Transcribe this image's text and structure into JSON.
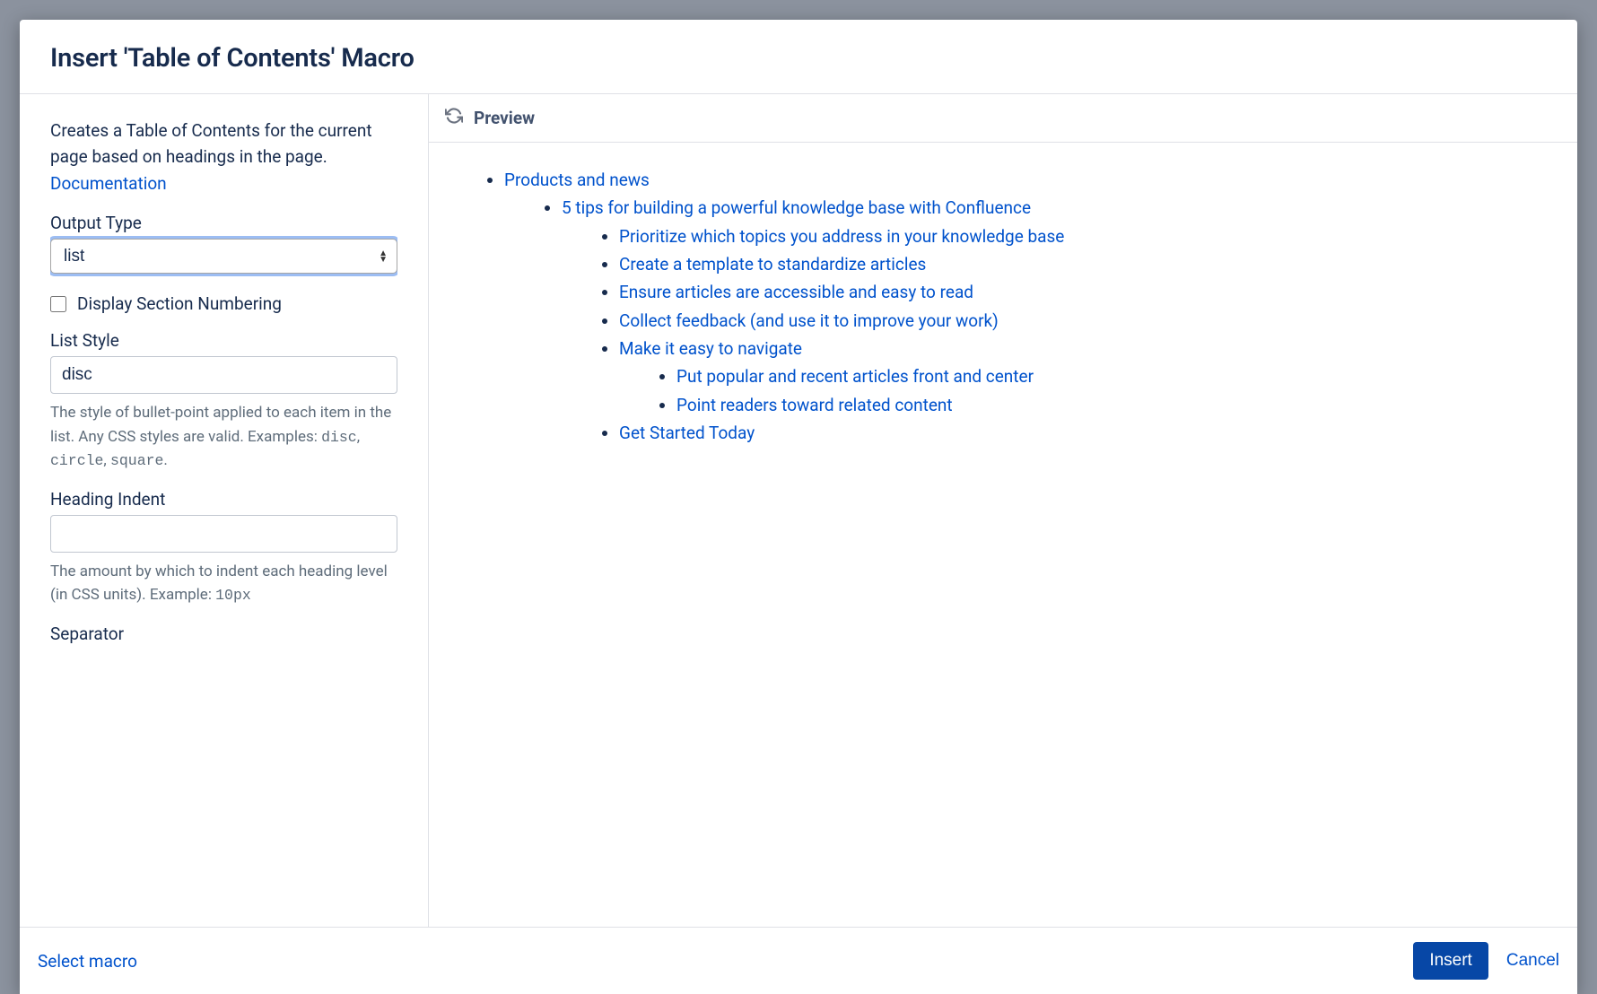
{
  "dialog": {
    "title": "Insert 'Table of Contents' Macro"
  },
  "sidebar": {
    "description_text": "Creates a Table of Contents for the current page based on headings in the page. ",
    "documentation_link": "Documentation",
    "output_type": {
      "label": "Output Type",
      "value": "list"
    },
    "display_section_numbering": {
      "label": "Display Section Numbering",
      "checked": false
    },
    "list_style": {
      "label": "List Style",
      "value": "disc",
      "help_prefix": "The style of bullet-point applied to each item in the list. Any CSS styles are valid. Examples: ",
      "example1": "disc",
      "example2": "circle",
      "example3": "square"
    },
    "heading_indent": {
      "label": "Heading Indent",
      "value": "",
      "help_prefix": "The amount by which to indent each heading level (in CSS units). Example: ",
      "example": "10px"
    },
    "separator": {
      "label": "Separator"
    }
  },
  "preview": {
    "title": "Preview",
    "items": {
      "l0": "Products and news",
      "l1": "5 tips for building a powerful knowledge base with Confluence",
      "l2a": "Prioritize which topics you address in your knowledge base",
      "l2b": "Create a template to standardize articles",
      "l2c": "Ensure articles are accessible and easy to read",
      "l2d": "Collect feedback (and use it to improve your work)",
      "l2e": "Make it easy to navigate",
      "l3a": "Put popular and recent articles front and center",
      "l3b": "Point readers toward related content",
      "l2f": "Get Started Today"
    }
  },
  "footer": {
    "select_macro": "Select macro",
    "insert": "Insert",
    "cancel": "Cancel"
  }
}
